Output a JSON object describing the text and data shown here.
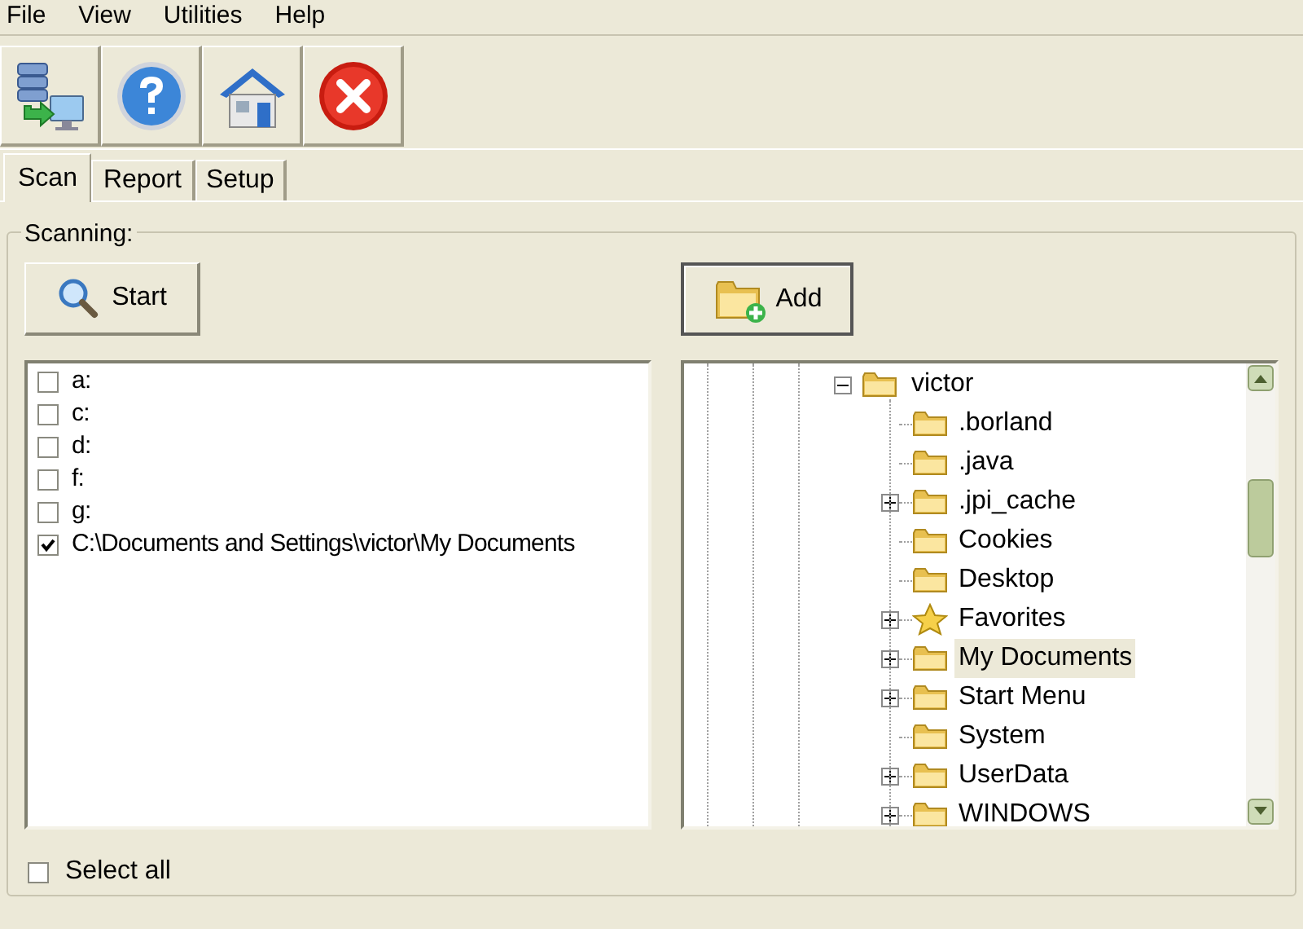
{
  "menu": [
    "File",
    "View",
    "Utilities",
    "Help"
  ],
  "toolbar": [
    {
      "kind": "transfer"
    },
    {
      "kind": "help"
    },
    {
      "kind": "home"
    },
    {
      "kind": "close"
    }
  ],
  "tabs": [
    {
      "label": "Scan",
      "selected": true
    },
    {
      "label": "Report",
      "selected": false
    },
    {
      "label": "Setup",
      "selected": false
    }
  ],
  "group": {
    "title": "Scanning:"
  },
  "start_button": "Start",
  "add_button": "Add",
  "paths": [
    {
      "label": "a:",
      "checked": false
    },
    {
      "label": "c:",
      "checked": false
    },
    {
      "label": "d:",
      "checked": false
    },
    {
      "label": "f:",
      "checked": false
    },
    {
      "label": "g:",
      "checked": false
    },
    {
      "label": "C:\\Documents and Settings\\victor\\My Documents",
      "checked": true
    }
  ],
  "tree": {
    "label": "victor",
    "kind": "folder",
    "expanded": true,
    "selected": false,
    "children": [
      {
        "label": ".borland",
        "kind": "folder",
        "expandable": false,
        "selected": false
      },
      {
        "label": ".java",
        "kind": "folder",
        "expandable": false,
        "selected": false
      },
      {
        "label": ".jpi_cache",
        "kind": "folder",
        "expandable": true,
        "selected": false
      },
      {
        "label": "Cookies",
        "kind": "folder",
        "expandable": false,
        "selected": false
      },
      {
        "label": "Desktop",
        "kind": "folder",
        "expandable": false,
        "selected": false
      },
      {
        "label": "Favorites",
        "kind": "star",
        "expandable": true,
        "selected": false
      },
      {
        "label": "My Documents",
        "kind": "folder",
        "expandable": true,
        "selected": true
      },
      {
        "label": "Start Menu",
        "kind": "folder",
        "expandable": true,
        "selected": false
      },
      {
        "label": "System",
        "kind": "folder",
        "expandable": false,
        "selected": false
      },
      {
        "label": "UserData",
        "kind": "folder",
        "expandable": true,
        "selected": false
      },
      {
        "label": "WINDOWS",
        "kind": "folder",
        "expandable": true,
        "selected": false
      }
    ]
  },
  "select_all": {
    "label": "Select all",
    "checked": false
  }
}
